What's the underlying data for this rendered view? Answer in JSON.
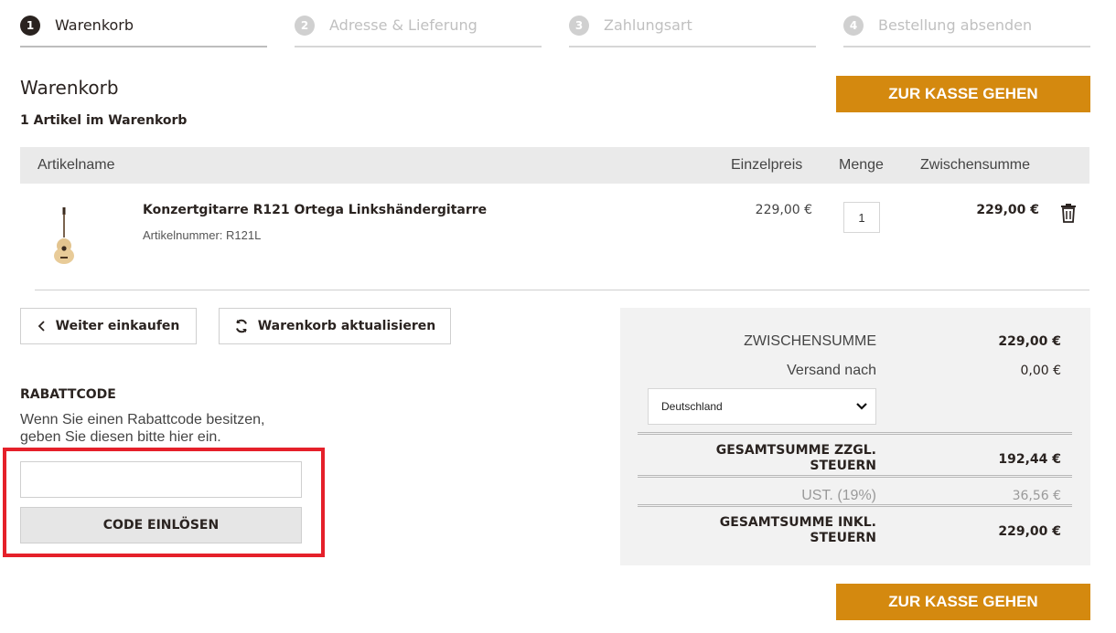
{
  "stepper": [
    {
      "num": "1",
      "label": "Warenkorb",
      "active": true
    },
    {
      "num": "2",
      "label": "Adresse & Lieferung",
      "active": false
    },
    {
      "num": "3",
      "label": "Zahlungsart",
      "active": false
    },
    {
      "num": "4",
      "label": "Bestellung absenden",
      "active": false
    }
  ],
  "page": {
    "title": "Warenkorb",
    "item_count": "1 Artikel im Warenkorb",
    "checkout_label": "ZUR KASSE GEHEN"
  },
  "table": {
    "headers": {
      "name": "Artikelname",
      "unit_price": "Einzelpreis",
      "quantity": "Menge",
      "subtotal": "Zwischensumme"
    },
    "rows": [
      {
        "name": "Konzertgitarre R121 Ortega Linkshändergitarre",
        "sku_label": "Artikelnummer:",
        "sku": "R121L",
        "unit_price": "229,00 €",
        "quantity": "1",
        "subtotal": "229,00 €",
        "image_icon": "guitar-icon"
      }
    ]
  },
  "actions": {
    "continue_label": "Weiter einkaufen",
    "update_label": "Warenkorb aktualisieren"
  },
  "coupon": {
    "title": "RABATTCODE",
    "description": "Wenn Sie einen Rabattcode besitzen, geben Sie diesen bitte hier ein.",
    "input_value": "",
    "button_label": "CODE EINLÖSEN"
  },
  "totals": {
    "subtotal_label": "ZWISCHENSUMME",
    "subtotal_value": "229,00 €",
    "shipping_label": "Versand nach",
    "shipping_value": "0,00 €",
    "country": "Deutschland",
    "net_total_label": "GESAMTSUMME ZZGL. STEUERN",
    "net_total_value": "192,44 €",
    "vat_label": "UST. (19%)",
    "vat_value": "36,56 €",
    "gross_total_label": "GESAMTSUMME INKL. STEUERN",
    "gross_total_value": "229,00 €"
  },
  "colors": {
    "accent": "#d4890f",
    "highlight": "#e5202a",
    "dark": "#2a2320"
  }
}
